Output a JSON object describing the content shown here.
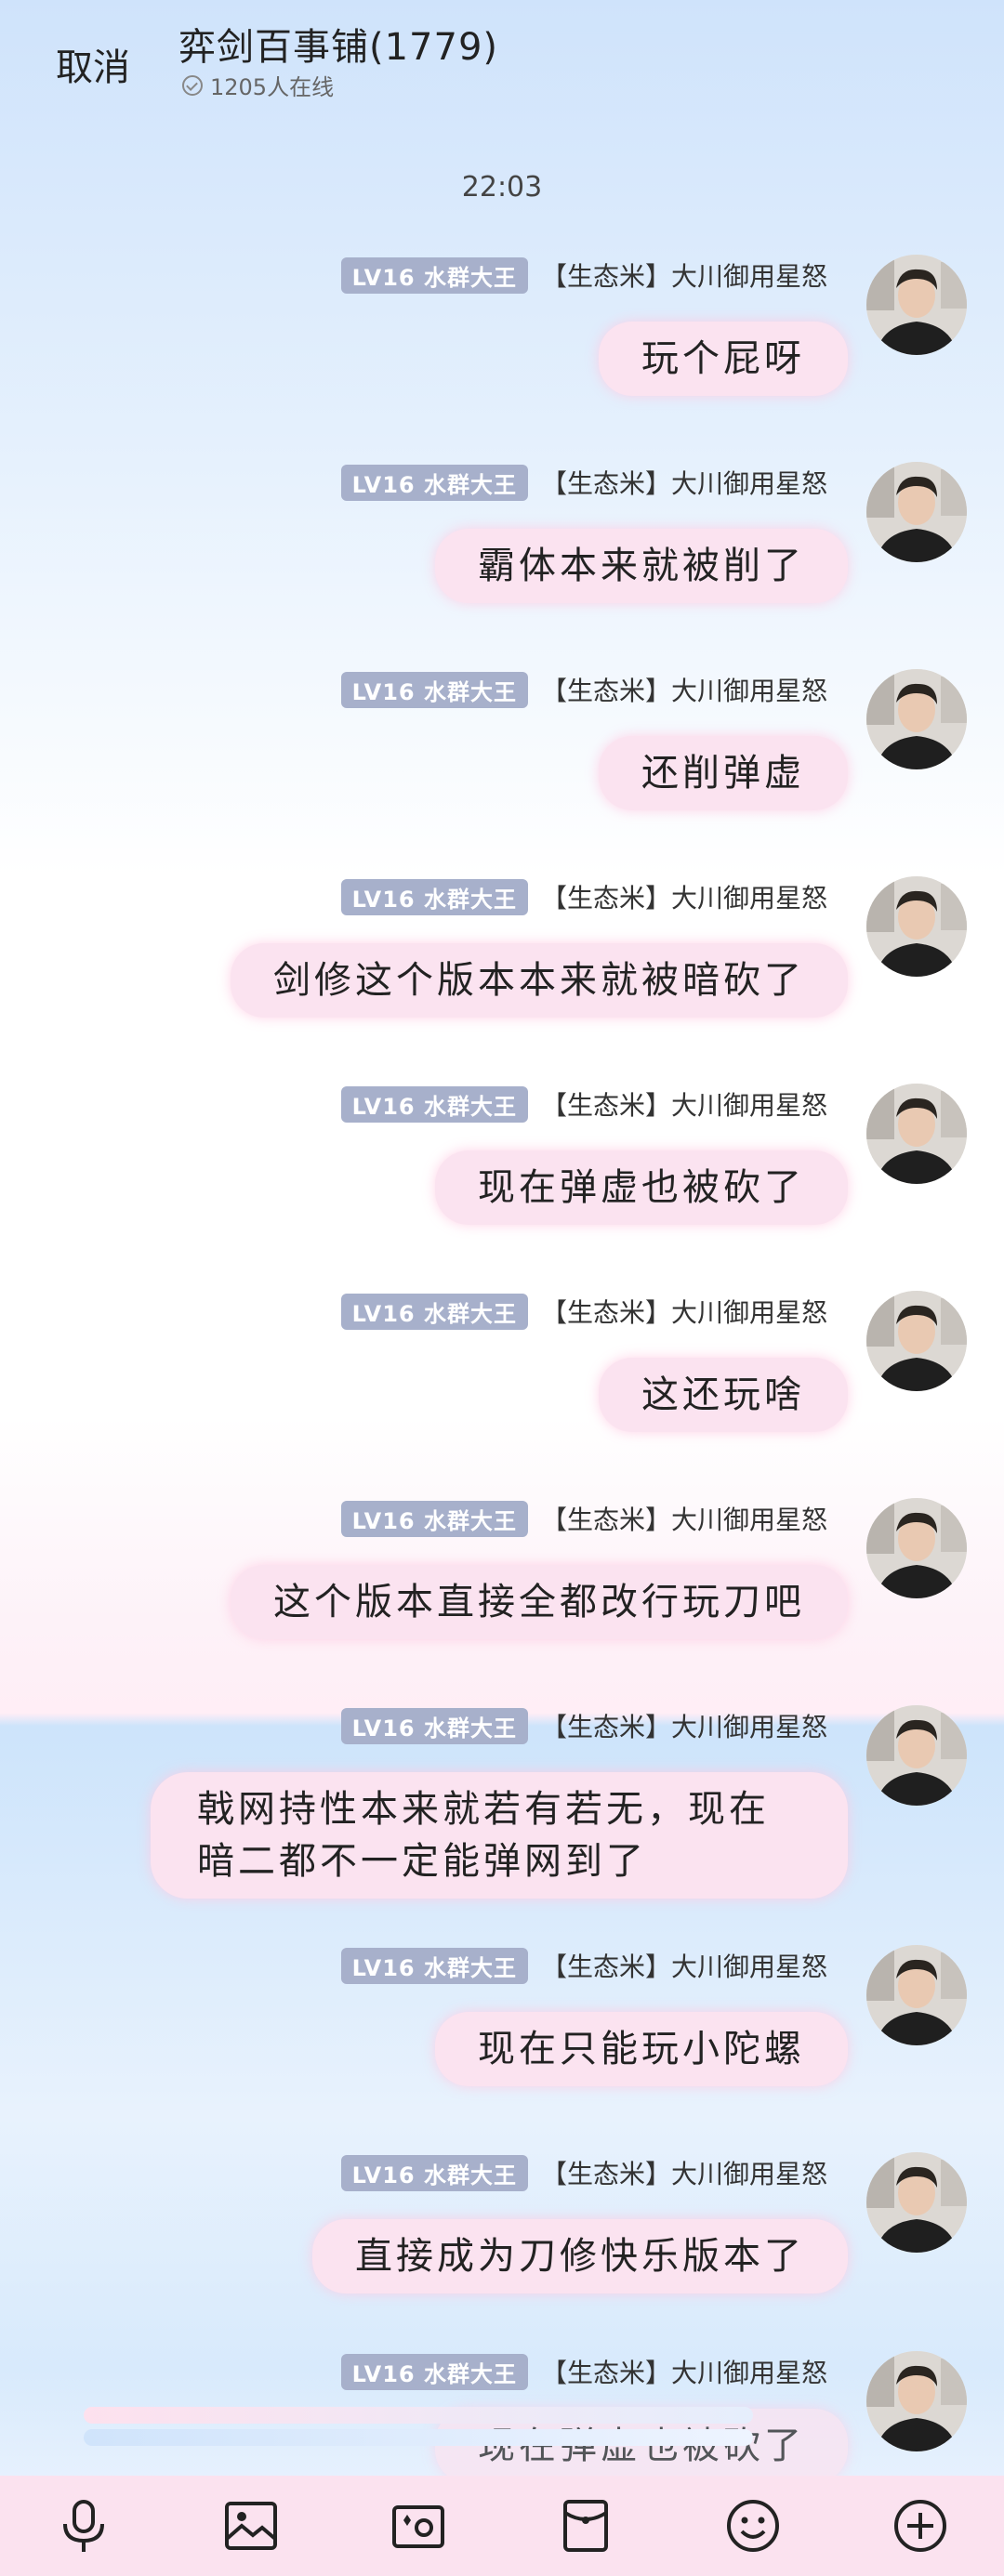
{
  "header": {
    "cancel_label": "取消",
    "title": "弈剑百事铺(1779)",
    "online_text": "1205人在线"
  },
  "timestamp": "22:03",
  "sender": {
    "badge": "LV16 水群大王",
    "name": "【生态米】大川御用星怒"
  },
  "messages": [
    {
      "text": "玩个屁呀"
    },
    {
      "text": "霸体本来就被削了"
    },
    {
      "text": "还削弹虚"
    },
    {
      "text": "剑修这个版本本来就被暗砍了"
    },
    {
      "text": "现在弹虚也被砍了"
    },
    {
      "text": "这还玩啥"
    },
    {
      "text": "这个版本直接全都改行玩刀吧"
    },
    {
      "text": "戟网持性本来就若有若无，现在暗二都不一定能弹网到了"
    },
    {
      "text": "现在只能玩小陀螺"
    },
    {
      "text": "直接成为刀修快乐版本了"
    },
    {
      "text": "现在弹虚也被砍了"
    }
  ],
  "toolbar": {
    "items": [
      "microphone-icon",
      "image-icon",
      "camera-icon",
      "red-packet-icon",
      "emoji-icon",
      "plus-icon"
    ]
  },
  "colors": {
    "bubble": "#fbe3f0",
    "badge": "#a7b0cb",
    "toolbar": "#fbe2ef"
  }
}
